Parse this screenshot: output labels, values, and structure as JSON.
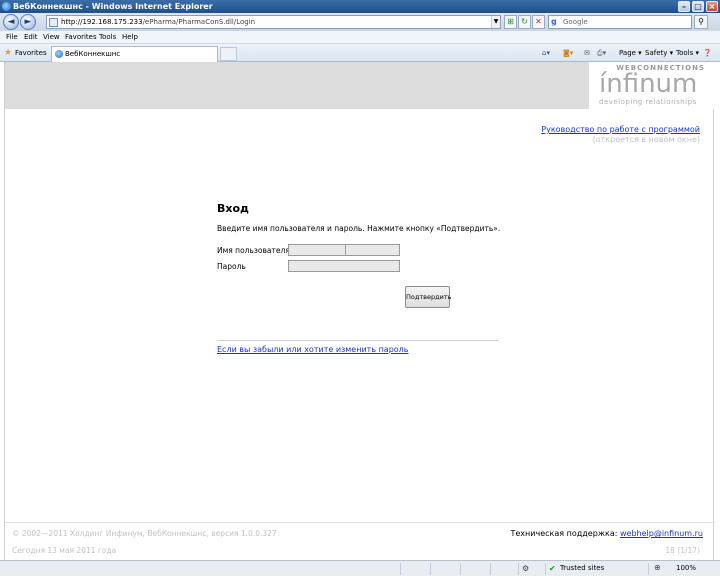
{
  "window": {
    "title": "ВебКоннекшнс - Windows Internet Explorer",
    "minimize": "–",
    "maximize": "□",
    "close": "×"
  },
  "nav": {
    "back": "◄",
    "forward": "►",
    "url_host": "http://192.168.175.233",
    "url_path": "/ePharma/PharmaConS.dll/Login",
    "search_placeholder": "Google",
    "search_logo": "g"
  },
  "menu": [
    "File",
    "Edit",
    "View",
    "Favorites",
    "Tools",
    "Help"
  ],
  "favbar": {
    "favorites_label": "Favorites",
    "tab_label": "ВебКоннекшнс",
    "tools": [
      "Page ▾",
      "Safety ▾",
      "Tools ▾"
    ]
  },
  "brand": {
    "webconnections": "WEBCONNECTIONS",
    "name": "ínfinum",
    "tagline": "developing relationships"
  },
  "manual": {
    "link": "Руководство по работе с программой",
    "note": "(откроется в новом окне)"
  },
  "login": {
    "title": "Вход",
    "hint": "Введите имя пользователя и пароль. Нажмите кнопку «Подтвердить».",
    "user_label": "Имя пользователя",
    "pass_label": "Пароль",
    "submit": "Подтвердить",
    "forgot_link": "Если вы забыли или хотите изменить пароль"
  },
  "footer": {
    "copyright": "© 2002—2011 Холдинг Инфинум, ВебКоннекшнс, версия 1.0.0.327",
    "date_note": "Сегодня 13 мая 2011 года",
    "support_label": "Техническая поддержка: ",
    "support_email": "webhelp@infinum.ru",
    "counter": "18 (1/17)"
  },
  "status": {
    "zone": "Trusted sites",
    "zoom": "100%"
  }
}
